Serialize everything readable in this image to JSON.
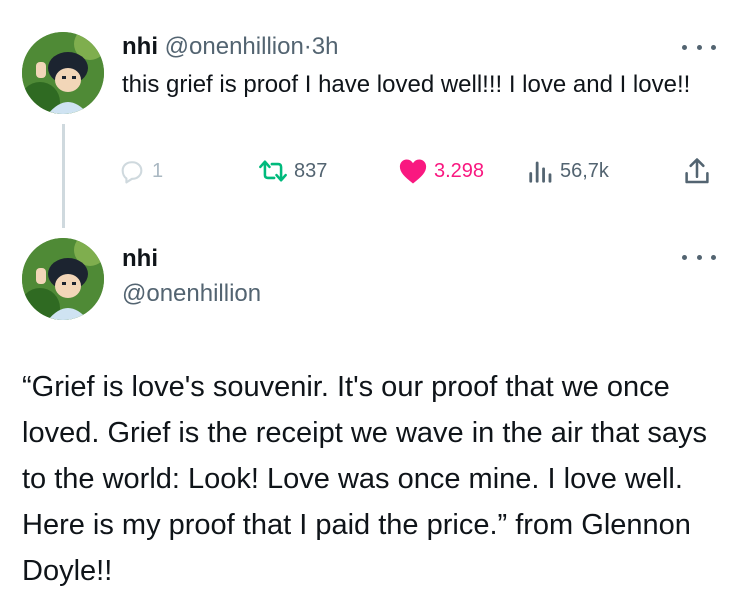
{
  "tweets": [
    {
      "name": "nhi",
      "handle": "@onenhillion",
      "separator": "·",
      "time": "3h",
      "text": "this grief is proof I have loved well!!! I love and I love!!",
      "actions": {
        "replies": "1",
        "reposts": "837",
        "likes": "3.298",
        "views": "56,7k"
      }
    },
    {
      "name": "nhi",
      "handle": "@onenhillion",
      "text": "“Grief is love's souvenir. It's our proof that we once loved. Grief is the receipt we wave in the air that says to the world: Look! Love was once mine. I love well. Here is my proof that I paid the price.” from Glennon Doyle!!"
    }
  ],
  "icons": {
    "reply": "reply-icon",
    "repost": "repost-icon",
    "like": "heart-icon",
    "views": "views-icon",
    "share": "share-icon",
    "more": "more-icon"
  },
  "colors": {
    "text": "#0f1419",
    "secondary": "#536471",
    "like": "#f91880",
    "thread_line": "#cfd9de"
  }
}
